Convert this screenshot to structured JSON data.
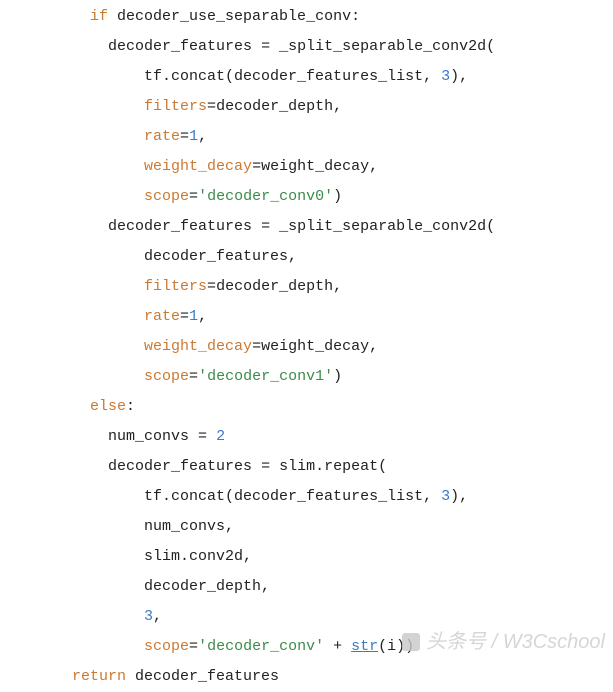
{
  "code": {
    "lines": [
      {
        "indent": 10,
        "tokens": [
          {
            "t": "kw",
            "v": "if"
          },
          {
            "t": "plain",
            "v": " decoder_use_separable_conv:"
          }
        ]
      },
      {
        "indent": 12,
        "tokens": [
          {
            "t": "plain",
            "v": "decoder_features "
          },
          {
            "t": "op",
            "v": "="
          },
          {
            "t": "plain",
            "v": " _split_separable_conv2d("
          }
        ]
      },
      {
        "indent": 16,
        "tokens": [
          {
            "t": "plain",
            "v": "tf.concat(decoder_features_list, "
          },
          {
            "t": "num",
            "v": "3"
          },
          {
            "t": "plain",
            "v": "),"
          }
        ]
      },
      {
        "indent": 16,
        "tokens": [
          {
            "t": "param",
            "v": "filters"
          },
          {
            "t": "op",
            "v": "="
          },
          {
            "t": "plain",
            "v": "decoder_depth,"
          }
        ]
      },
      {
        "indent": 16,
        "tokens": [
          {
            "t": "param",
            "v": "rate"
          },
          {
            "t": "op",
            "v": "="
          },
          {
            "t": "num",
            "v": "1"
          },
          {
            "t": "plain",
            "v": ","
          }
        ]
      },
      {
        "indent": 16,
        "tokens": [
          {
            "t": "param",
            "v": "weight_decay"
          },
          {
            "t": "op",
            "v": "="
          },
          {
            "t": "plain",
            "v": "weight_decay,"
          }
        ]
      },
      {
        "indent": 16,
        "tokens": [
          {
            "t": "param",
            "v": "scope"
          },
          {
            "t": "op",
            "v": "="
          },
          {
            "t": "str",
            "v": "'decoder_conv0'"
          },
          {
            "t": "plain",
            "v": ")"
          }
        ]
      },
      {
        "indent": 12,
        "tokens": [
          {
            "t": "plain",
            "v": "decoder_features "
          },
          {
            "t": "op",
            "v": "="
          },
          {
            "t": "plain",
            "v": " _split_separable_conv2d("
          }
        ]
      },
      {
        "indent": 16,
        "tokens": [
          {
            "t": "plain",
            "v": "decoder_features,"
          }
        ]
      },
      {
        "indent": 16,
        "tokens": [
          {
            "t": "param",
            "v": "filters"
          },
          {
            "t": "op",
            "v": "="
          },
          {
            "t": "plain",
            "v": "decoder_depth,"
          }
        ]
      },
      {
        "indent": 16,
        "tokens": [
          {
            "t": "param",
            "v": "rate"
          },
          {
            "t": "op",
            "v": "="
          },
          {
            "t": "num",
            "v": "1"
          },
          {
            "t": "plain",
            "v": ","
          }
        ]
      },
      {
        "indent": 16,
        "tokens": [
          {
            "t": "param",
            "v": "weight_decay"
          },
          {
            "t": "op",
            "v": "="
          },
          {
            "t": "plain",
            "v": "weight_decay,"
          }
        ]
      },
      {
        "indent": 16,
        "tokens": [
          {
            "t": "param",
            "v": "scope"
          },
          {
            "t": "op",
            "v": "="
          },
          {
            "t": "str",
            "v": "'decoder_conv1'"
          },
          {
            "t": "plain",
            "v": ")"
          }
        ]
      },
      {
        "indent": 10,
        "tokens": [
          {
            "t": "kw",
            "v": "else"
          },
          {
            "t": "plain",
            "v": ":"
          }
        ]
      },
      {
        "indent": 12,
        "tokens": [
          {
            "t": "plain",
            "v": "num_convs "
          },
          {
            "t": "op",
            "v": "="
          },
          {
            "t": "plain",
            "v": " "
          },
          {
            "t": "num",
            "v": "2"
          }
        ]
      },
      {
        "indent": 12,
        "tokens": [
          {
            "t": "plain",
            "v": "decoder_features "
          },
          {
            "t": "op",
            "v": "="
          },
          {
            "t": "plain",
            "v": " slim.repeat("
          }
        ]
      },
      {
        "indent": 16,
        "tokens": [
          {
            "t": "plain",
            "v": "tf.concat(decoder_features_list, "
          },
          {
            "t": "num",
            "v": "3"
          },
          {
            "t": "plain",
            "v": "),"
          }
        ]
      },
      {
        "indent": 16,
        "tokens": [
          {
            "t": "plain",
            "v": "num_convs,"
          }
        ]
      },
      {
        "indent": 16,
        "tokens": [
          {
            "t": "plain",
            "v": "slim.conv2d,"
          }
        ]
      },
      {
        "indent": 16,
        "tokens": [
          {
            "t": "plain",
            "v": "decoder_depth,"
          }
        ]
      },
      {
        "indent": 16,
        "tokens": [
          {
            "t": "num",
            "v": "3"
          },
          {
            "t": "plain",
            "v": ","
          }
        ]
      },
      {
        "indent": 16,
        "tokens": [
          {
            "t": "param",
            "v": "scope"
          },
          {
            "t": "op",
            "v": "="
          },
          {
            "t": "str",
            "v": "'decoder_conv'"
          },
          {
            "t": "plain",
            "v": " "
          },
          {
            "t": "op",
            "v": "+"
          },
          {
            "t": "plain",
            "v": " "
          },
          {
            "t": "builtin",
            "v": "str"
          },
          {
            "t": "plain",
            "v": "(i))"
          }
        ]
      },
      {
        "indent": 8,
        "tokens": [
          {
            "t": "kw",
            "v": "return"
          },
          {
            "t": "plain",
            "v": " decoder_features"
          }
        ]
      }
    ]
  },
  "watermark": {
    "text": "头条号 / W3Cschool"
  }
}
